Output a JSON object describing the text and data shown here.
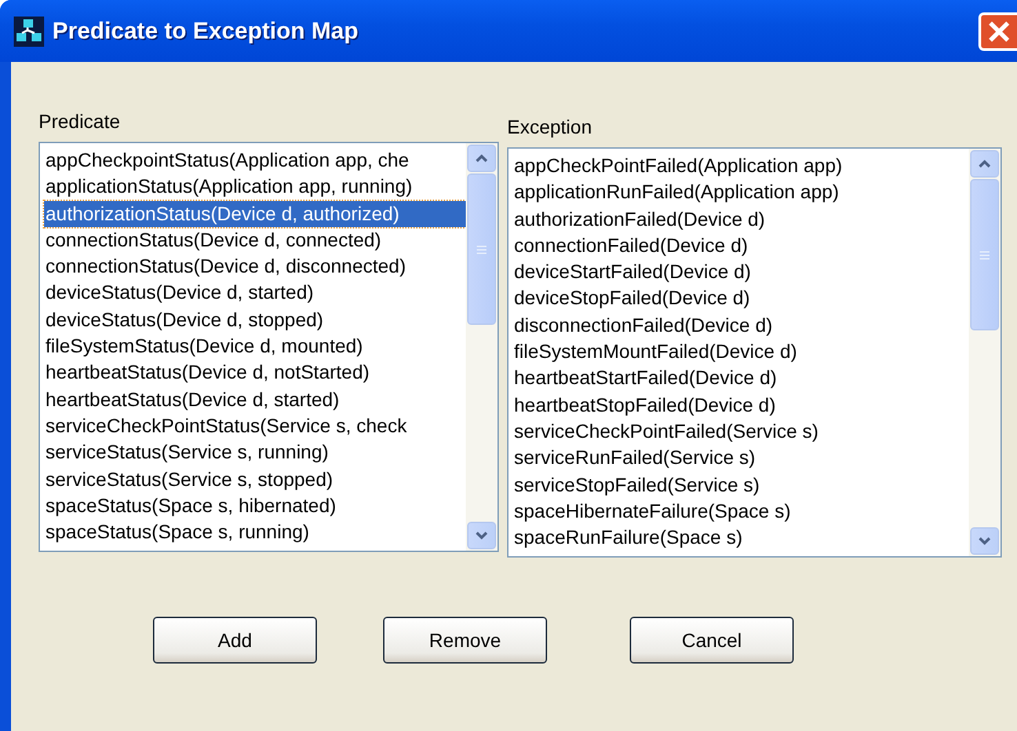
{
  "window": {
    "title": "Predicate to Exception Map"
  },
  "predicate": {
    "label": "Predicate",
    "items": [
      {
        "text": "appCheckpointStatus(Application app, che",
        "selected": false
      },
      {
        "text": "applicationStatus(Application app, running)",
        "selected": false
      },
      {
        "text": "authorizationStatus(Device d, authorized)",
        "selected": true
      },
      {
        "text": "connectionStatus(Device d, connected)",
        "selected": false
      },
      {
        "text": "connectionStatus(Device d, disconnected)",
        "selected": false
      },
      {
        "text": "deviceStatus(Device d, started)",
        "selected": false
      },
      {
        "text": "deviceStatus(Device d, stopped)",
        "selected": false
      },
      {
        "text": "fileSystemStatus(Device d, mounted)",
        "selected": false
      },
      {
        "text": "heartbeatStatus(Device d, notStarted)",
        "selected": false
      },
      {
        "text": "heartbeatStatus(Device d, started)",
        "selected": false
      },
      {
        "text": "serviceCheckPointStatus(Service s, check",
        "selected": false
      },
      {
        "text": "serviceStatus(Service s, running)",
        "selected": false
      },
      {
        "text": "serviceStatus(Service s, stopped)",
        "selected": false
      },
      {
        "text": "spaceStatus(Space s, hibernated)",
        "selected": false
      },
      {
        "text": "spaceStatus(Space s, running)",
        "selected": false
      }
    ]
  },
  "exception": {
    "label": "Exception",
    "items": [
      {
        "text": "appCheckPointFailed(Application app)",
        "selected": false
      },
      {
        "text": "applicationRunFailed(Application app)",
        "selected": false
      },
      {
        "text": "authorizationFailed(Device d)",
        "selected": false
      },
      {
        "text": "connectionFailed(Device d)",
        "selected": false
      },
      {
        "text": "deviceStartFailed(Device d)",
        "selected": false
      },
      {
        "text": "deviceStopFailed(Device d)",
        "selected": false
      },
      {
        "text": "disconnectionFailed(Device d)",
        "selected": false
      },
      {
        "text": "fileSystemMountFailed(Device d)",
        "selected": false
      },
      {
        "text": "heartbeatStartFailed(Device d)",
        "selected": false
      },
      {
        "text": "heartbeatStopFailed(Device d)",
        "selected": false
      },
      {
        "text": "serviceCheckPointFailed(Service s)",
        "selected": false
      },
      {
        "text": "serviceRunFailed(Service s)",
        "selected": false
      },
      {
        "text": "serviceStopFailed(Service s)",
        "selected": false
      },
      {
        "text": "spaceHibernateFailure(Space s)",
        "selected": false
      },
      {
        "text": "spaceRunFailure(Space s)",
        "selected": false
      }
    ]
  },
  "buttons": [
    "Add",
    "Remove",
    "Cancel"
  ]
}
